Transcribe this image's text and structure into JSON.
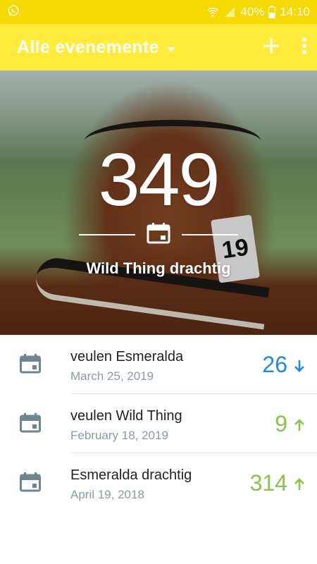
{
  "status_bar": {
    "battery": "40%",
    "time": "14:10",
    "icons": [
      "whatsapp-icon",
      "wifi-icon",
      "signal-icon",
      "battery-icon"
    ]
  },
  "app_bar": {
    "title": "Alle evenemente",
    "icons": [
      "dropdown-arrow-icon",
      "add-icon",
      "more-vert-icon"
    ]
  },
  "hero": {
    "count": "349",
    "label": "Wild Thing drachtig",
    "tag_text": "19",
    "icon": "calendar-icon"
  },
  "events": [
    {
      "title": "veulen Esmeralda",
      "date": "March 25, 2019",
      "value": "26",
      "direction": "down",
      "color": "#1e88e5"
    },
    {
      "title": "veulen Wild Thing",
      "date": "February 18, 2019",
      "value": "9",
      "direction": "up",
      "color": "#8bc34a"
    },
    {
      "title": "Esmeralda drachtig",
      "date": "April 19, 2018",
      "value": "314",
      "direction": "up",
      "color": "#8bc34a"
    }
  ],
  "colors": {
    "status_bar": "#f5d900",
    "app_bar": "#ffeb3b",
    "icon_gray": "#6f8590",
    "future": "#1e88e5",
    "past": "#8bc34a"
  }
}
